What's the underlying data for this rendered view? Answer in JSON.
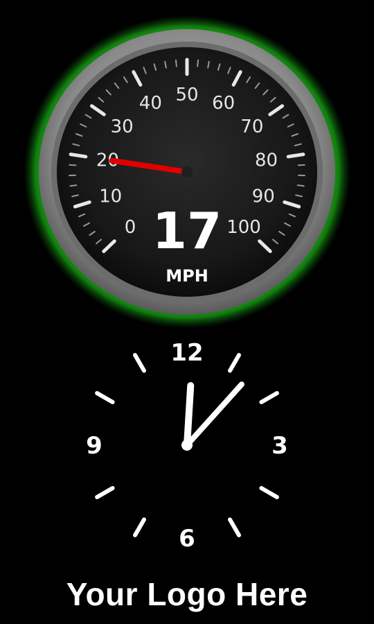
{
  "speedometer": {
    "value": 17,
    "unit": "MPH",
    "scale_min": 0,
    "scale_max": 100,
    "scale_labels": [
      "0",
      "10",
      "20",
      "30",
      "40",
      "50",
      "60",
      "70",
      "80",
      "90",
      "100"
    ],
    "needle_value": 20,
    "colors": {
      "glow": "#1fa81a",
      "bezel": "#8e8e8e",
      "face": "#1c1c1c",
      "needle": "#e00000",
      "text": "#e6e6e6"
    }
  },
  "clock": {
    "hour_labels": [
      "12",
      "3",
      "6",
      "9"
    ],
    "hour": 12,
    "minute": 7,
    "colors": {
      "face": "#000000",
      "marks": "#ffffff"
    }
  },
  "logo": {
    "text": "Your Logo Here"
  }
}
